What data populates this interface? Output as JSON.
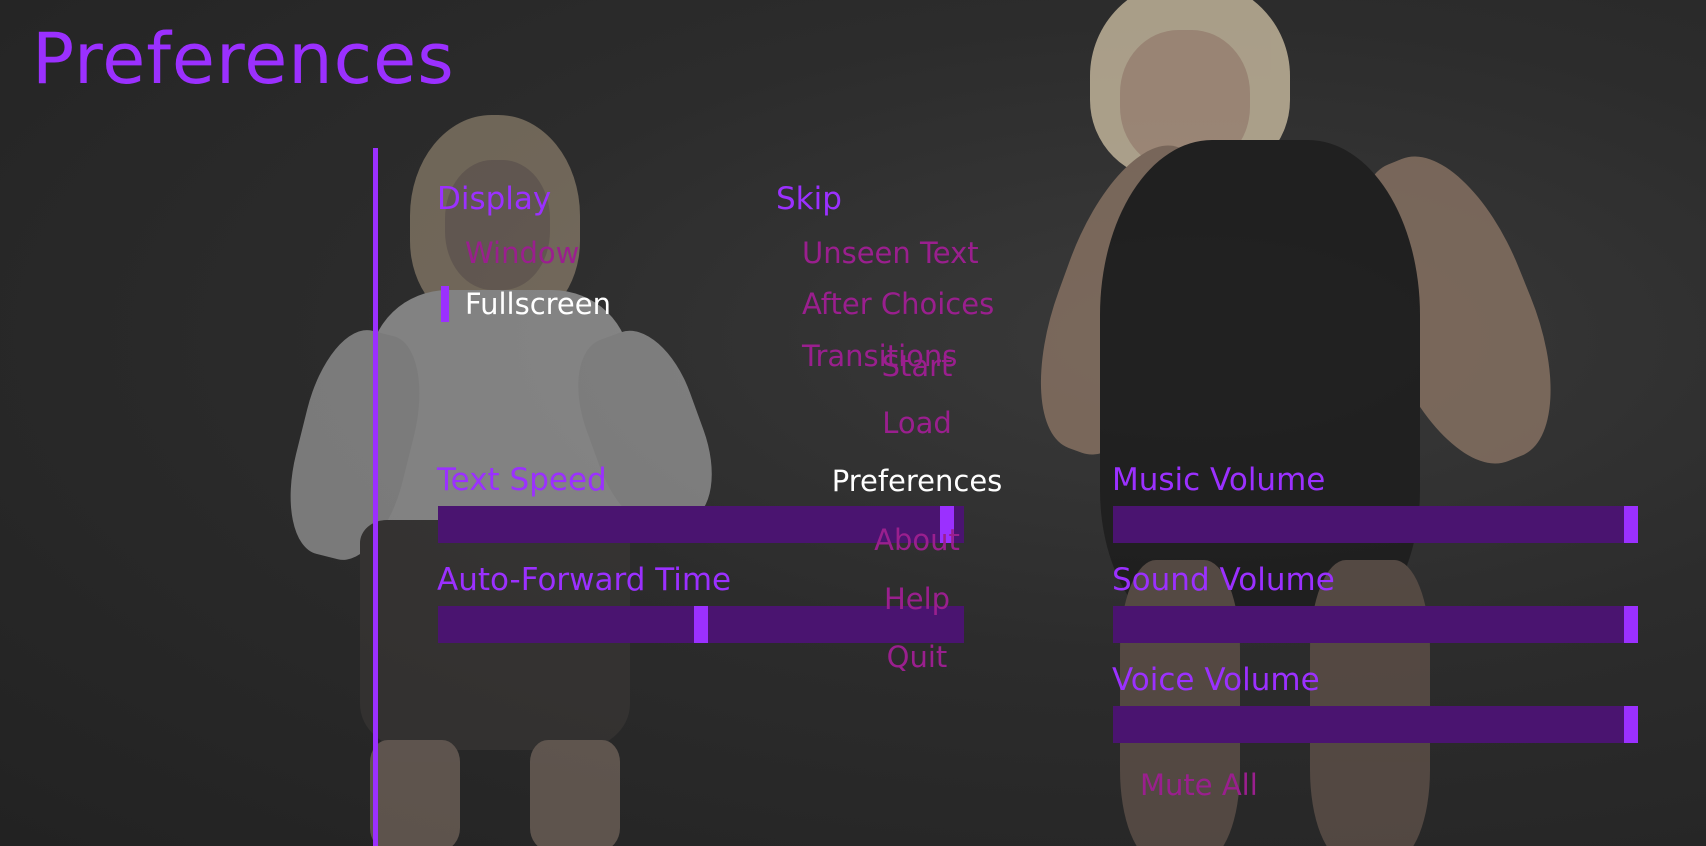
{
  "title": "Preferences",
  "display": {
    "header": "Display",
    "options": [
      {
        "label": "Window",
        "selected": false
      },
      {
        "label": "Fullscreen",
        "selected": true
      }
    ]
  },
  "skip": {
    "header": "Skip",
    "options": [
      {
        "label": "Unseen Text"
      },
      {
        "label": "After Choices"
      },
      {
        "label": "Transitions"
      }
    ]
  },
  "sliders": {
    "text_speed": {
      "label": "Text Speed",
      "value": 0.98
    },
    "auto_forward": {
      "label": "Auto-Forward Time",
      "value": 0.5
    },
    "music": {
      "label": "Music Volume",
      "value": 1.0
    },
    "sound": {
      "label": "Sound Volume",
      "value": 1.0
    },
    "voice": {
      "label": "Voice Volume",
      "value": 1.0
    }
  },
  "mute_all": "Mute All",
  "nav": [
    {
      "label": "Start",
      "active": false
    },
    {
      "label": "Load",
      "active": false
    },
    {
      "label": "Preferences",
      "active": true
    },
    {
      "label": "About",
      "active": false
    },
    {
      "label": "Help",
      "active": false
    },
    {
      "label": "Quit",
      "active": false
    }
  ],
  "colors": {
    "accent": "#9b30ff",
    "idle_text": "#9a1f8e",
    "selected_text": "#ffffff",
    "bar_track": "#4a1470"
  }
}
